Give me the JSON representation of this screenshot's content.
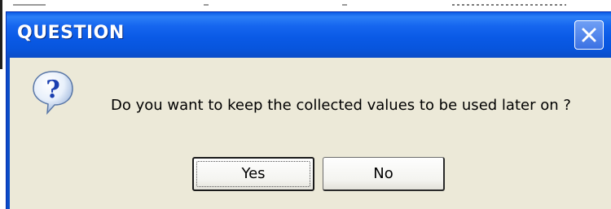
{
  "dialog": {
    "title": "QUESTION",
    "message": "Do you want to keep the collected values to be used later on ?",
    "icon": "question-icon",
    "close_icon": "close-icon"
  },
  "buttons": {
    "yes_label": "Yes",
    "no_label": "No"
  },
  "colors": {
    "titlebar": "#0a5ae6",
    "dialog_background": "#ece9d8",
    "title_text": "#ffffff"
  }
}
